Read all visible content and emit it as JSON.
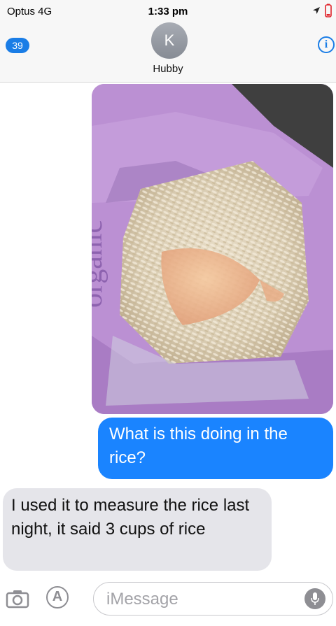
{
  "status_bar": {
    "carrier": "Optus  4G",
    "time": "1:33 pm",
    "icons": [
      "location-arrow-icon",
      "battery-icon"
    ]
  },
  "header": {
    "back_badge": "39",
    "avatar_initial": "K",
    "contact_name": "Hubby",
    "info_icon": "i"
  },
  "messages": [
    {
      "type": "image",
      "direction": "outgoing",
      "description_icon": "photo-attachment"
    },
    {
      "type": "text",
      "direction": "outgoing",
      "text": "What is this doing in the rice?"
    },
    {
      "type": "text",
      "direction": "incoming",
      "text": "I used it to measure the rice last night, it said 3 cups of rice"
    }
  ],
  "input_bar": {
    "placeholder": "iMessage",
    "icons": [
      "camera-icon",
      "app-store-icon",
      "microphone-icon"
    ]
  },
  "colors": {
    "outgoing_bubble": "#1a84ff",
    "incoming_bubble": "#e5e5ea",
    "accent": "#1a7de6",
    "bag_purple": "#b88fd0"
  }
}
